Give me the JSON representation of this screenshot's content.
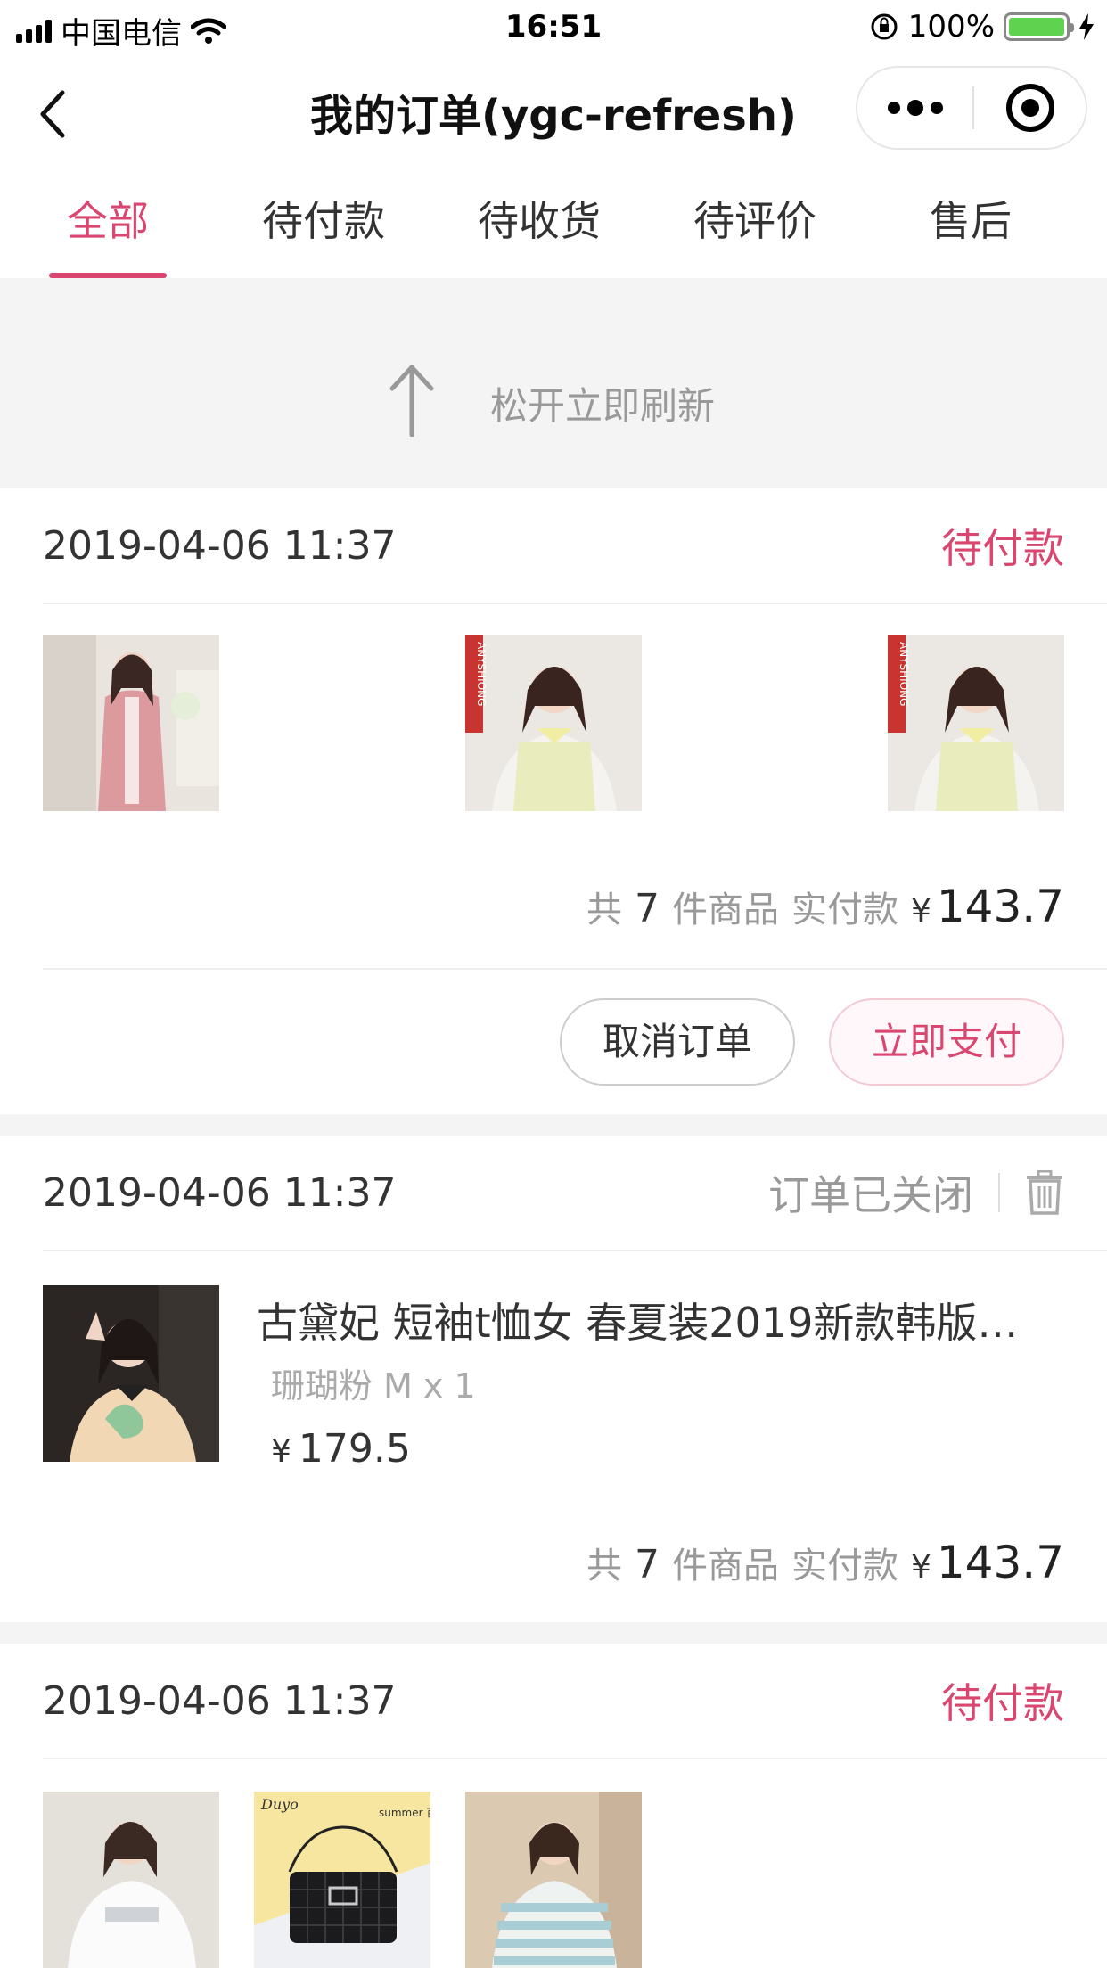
{
  "status_bar": {
    "carrier": "中国电信",
    "time": "16:51",
    "battery": "100%",
    "battery_level": 1.0
  },
  "nav": {
    "title": "我的订单(ygc-refresh)",
    "back_icon": "chevron-left-icon",
    "more_icon": "more-dots-icon",
    "target_icon": "target-icon"
  },
  "tabs": [
    {
      "label": "全部",
      "active": true
    },
    {
      "label": "待付款",
      "active": false
    },
    {
      "label": "待收货",
      "active": false
    },
    {
      "label": "待评价",
      "active": false
    },
    {
      "label": "售后",
      "active": false
    }
  ],
  "refresh": {
    "text": "松开立即刷新",
    "icon": "arrow-up-icon"
  },
  "colors": {
    "accent": "#d9466f",
    "background_gray": "#f4f4f4"
  },
  "orders": [
    {
      "date": "2019-04-06 11:37",
      "status": "待付款",
      "thumbnails": [
        "pink-cardigan",
        "yellow-lace-blouse",
        "yellow-lace-blouse"
      ],
      "summary": {
        "prefix": "共",
        "count": "7",
        "suffix": "件商品",
        "paid_label": "实付款",
        "currency": "¥",
        "amount": "143.7"
      },
      "buttons": {
        "cancel": "取消订单",
        "pay": "立即支付"
      }
    },
    {
      "date": "2019-04-06 11:37",
      "status": "订单已关闭",
      "delete_icon": "trash-icon",
      "item": {
        "title": "古黛妃 短袖t恤女 春夏装2019新款韩版…",
        "spec": "珊瑚粉 M x 1",
        "currency": "¥",
        "price": "179.5"
      },
      "summary": {
        "prefix": "共",
        "count": "7",
        "suffix": "件商品",
        "paid_label": "实付款",
        "currency": "¥",
        "amount": "143.7"
      }
    },
    {
      "date": "2019-04-06 11:37",
      "status": "待付款",
      "thumbnails": [
        "white-tshirt",
        "black-quilted-bag",
        "striped-tshirt"
      ],
      "bag_caption": "summer 百搭女王"
    }
  ]
}
